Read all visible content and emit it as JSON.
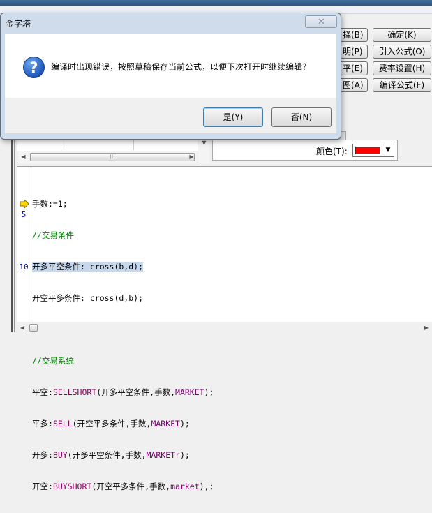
{
  "dialog": {
    "title": "金字塔",
    "message": "编译时出现错误，按照草稿保存当前公式，以便下次打开时继续编辑？",
    "icon": "question-icon",
    "buttons": {
      "yes": "是(Y)",
      "no": "否(N)"
    }
  },
  "side_buttons": {
    "partial": [
      "择(B)",
      "明(P)",
      "平(E)",
      "图(A)"
    ],
    "full": [
      "确定(K)",
      "引入公式(O)",
      "费率设置(H)",
      "编译公式(F)"
    ]
  },
  "color_field": {
    "label": "颜色(T):",
    "value": "#ff0000"
  },
  "gutter": {
    "line5": "5",
    "line10": "10"
  },
  "code_lines": {
    "l1": "手数:=1;",
    "l2": "//交易条件",
    "l3": "开多平空条件: cross(b,d);",
    "l4": "开空平多条件: cross(d,b);",
    "l5": "",
    "l6": "//交易系统",
    "l7a": "平空:",
    "l7b": "SELLSHORT",
    "l7c": "(开多平空条件,手数,",
    "l7d": "MARKET",
    "l7e": ");",
    "l8a": "平多:",
    "l8b": "SELL",
    "l8c": "(开空平多条件,手数,",
    "l8d": "MARKET",
    "l8e": ");",
    "l9a": "开多:",
    "l9b": "BUY",
    "l9c": "(开多平空条件,手数,",
    "l9d": "MARKETr",
    "l9e": ");",
    "l10a": "开空:",
    "l10b": "BUYSHORT",
    "l10c": "(开空平多条件,手数,",
    "l10d": "market",
    "l10e": "),;"
  }
}
